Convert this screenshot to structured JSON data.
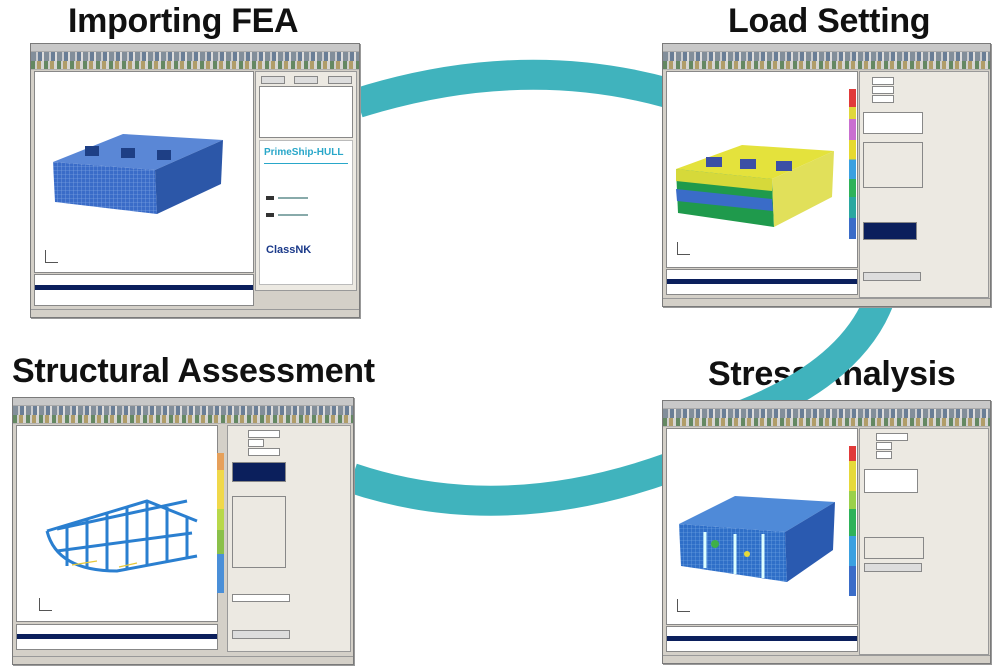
{
  "steps": {
    "importing": "Importing FEA",
    "load": "Load Setting",
    "structural": "Structural Assessment",
    "stress": "Stress Analysis"
  },
  "colors": {
    "arc": "#40b3bd",
    "mesh_blue": "#3a6cc8",
    "background": "#ffffff"
  },
  "import_window": {
    "brand_title": "PrimeShip-HULL",
    "brand_logo": "ClassNK"
  }
}
